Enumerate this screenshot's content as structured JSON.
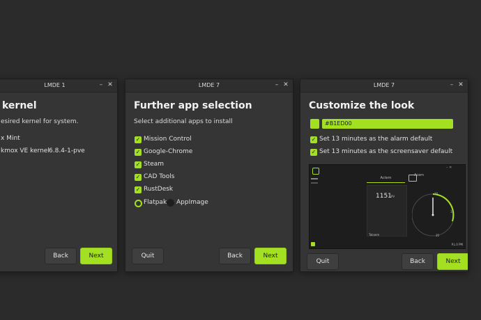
{
  "windows": [
    {
      "title": "LMDE 1",
      "heading": "kernel",
      "subtitle": "esired kernel for system.",
      "options": [
        "x Mint",
        "kmox VE kernel"
      ],
      "kernel_version": "6.8.4-1-pve",
      "back_label": "Back",
      "next_label": "Next"
    },
    {
      "title": "LMDE 7",
      "heading": "Further app selection",
      "subtitle": "Select additional apps to install",
      "apps": [
        "Mission Control",
        "Google-Chrome",
        "Steam",
        "CAD Tools",
        "RustDesk"
      ],
      "radio_options": [
        "Flatpak",
        "AppImage"
      ],
      "quit_label": "Quit",
      "back_label": "Back",
      "next_label": "Next"
    },
    {
      "title": "LMDE 7",
      "heading": "Customize the look",
      "color_hex": "#B1ED00",
      "settings": [
        "Set 13 minutes as the alarm default",
        "Set 13 minutes as the screensaver default"
      ],
      "preview": {
        "tab_label": "Actem",
        "panel_title": "Acem",
        "time": "1151",
        "time_suffix": "PV",
        "footer_label": "Takaem",
        "status": "P.L.0 PM",
        "dial_labels": [
          "10",
          "15",
          "35"
        ]
      },
      "quit_label": "Quit",
      "back_label": "Back",
      "next_label": "Next"
    }
  ],
  "colors": {
    "accent": "#a3e022",
    "window": "#353535",
    "desktop": "#2b2b2b"
  },
  "icons": {
    "minimize": "minimize-icon",
    "close": "close-icon",
    "check": "check-icon"
  }
}
